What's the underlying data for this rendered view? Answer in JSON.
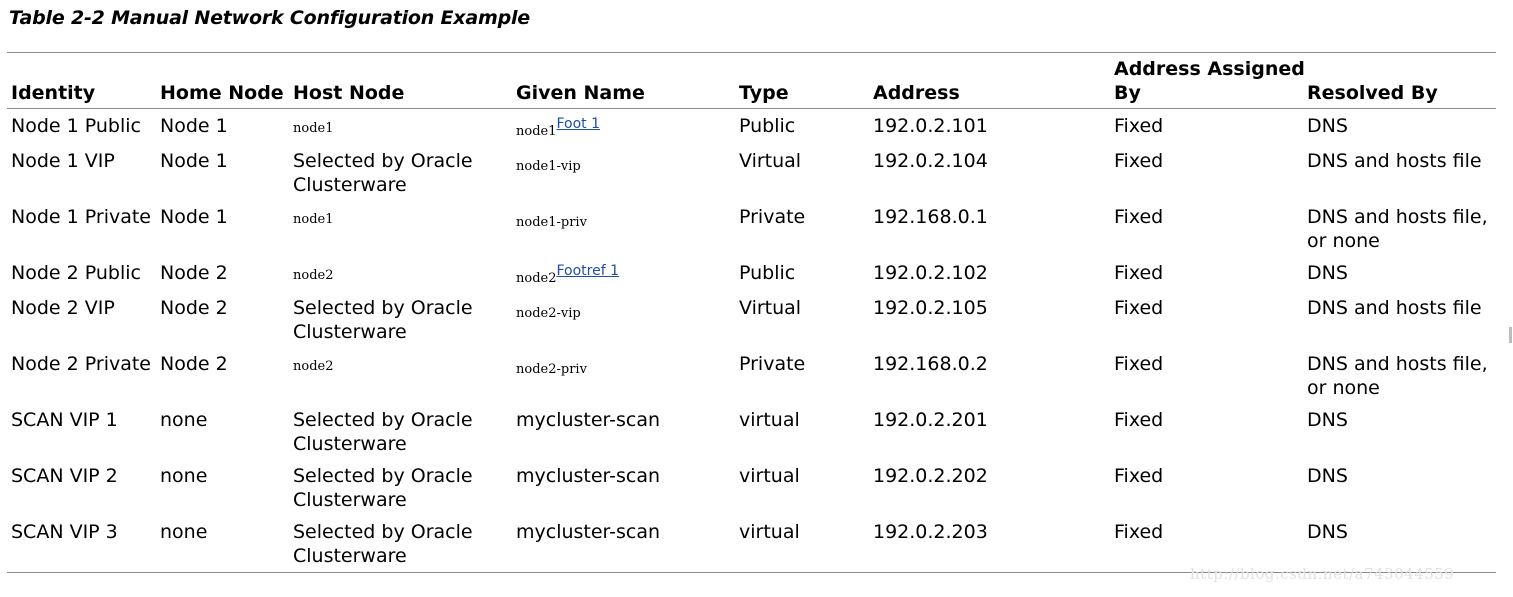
{
  "caption": "Table 2-2 Manual Network Configuration Example",
  "headers": {
    "identity": "Identity",
    "home_node": "Home Node",
    "host_node": "Host Node",
    "given_name": "Given Name",
    "type": "Type",
    "address": "Address",
    "assigned_line1": "Address Assigned",
    "assigned_line2": "By",
    "resolved_by": "Resolved By"
  },
  "rows": [
    {
      "identity": "Node 1 Public",
      "home": "Node 1",
      "host": "node1",
      "host_mono": true,
      "given": "node1",
      "given_mono": true,
      "footnote": "Foot 1 ",
      "type": "Public",
      "address": "192.0.2.101",
      "assigned": "Fixed",
      "resolved": "DNS"
    },
    {
      "identity": "Node 1 VIP",
      "home": "Node 1",
      "host": "Selected by Oracle\nClusterware",
      "host_mono": false,
      "given": "node1-vip",
      "given_mono": true,
      "type": "Virtual",
      "address": "192.0.2.104",
      "assigned": "Fixed",
      "resolved": "DNS and hosts file"
    },
    {
      "identity": "Node 1 Private",
      "home": "Node 1",
      "host": "node1",
      "host_mono": true,
      "given": "node1-priv",
      "given_mono": true,
      "type": "Private",
      "address": "192.168.0.1",
      "assigned": "Fixed",
      "resolved": "DNS and hosts file,\nor none"
    },
    {
      "identity": "Node 2 Public",
      "home": "Node 2",
      "host": "node2",
      "host_mono": true,
      "given": "node2",
      "given_mono": true,
      "footnote": "Footref 1",
      "type": "Public",
      "address": "192.0.2.102",
      "assigned": "Fixed",
      "resolved": "DNS"
    },
    {
      "identity": "Node 2 VIP",
      "home": "Node 2",
      "host": "Selected by Oracle\nClusterware",
      "host_mono": false,
      "given": "node2-vip",
      "given_mono": true,
      "type": "Virtual",
      "address": "192.0.2.105",
      "assigned": "Fixed",
      "resolved": "DNS and hosts file"
    },
    {
      "identity": "Node 2 Private",
      "home": "Node 2",
      "host": "node2",
      "host_mono": true,
      "given": "node2-priv",
      "given_mono": true,
      "type": "Private",
      "address": "192.168.0.2",
      "assigned": "Fixed",
      "resolved": "DNS and hosts file,\nor none"
    },
    {
      "identity": "SCAN VIP 1",
      "home": "none",
      "host": "Selected by Oracle\nClusterware",
      "host_mono": false,
      "given": "mycluster-scan",
      "given_mono": false,
      "type": "virtual",
      "address": "192.0.2.201",
      "assigned": "Fixed",
      "resolved": "DNS"
    },
    {
      "identity": "SCAN VIP 2",
      "home": "none",
      "host": "Selected by Oracle\nClusterware",
      "host_mono": false,
      "given": "mycluster-scan",
      "given_mono": false,
      "type": "virtual",
      "address": "192.0.2.202",
      "assigned": "Fixed",
      "resolved": "DNS"
    },
    {
      "identity": "SCAN VIP 3",
      "home": "none",
      "host": "Selected by Oracle\nClusterware",
      "host_mono": false,
      "given": "mycluster-scan",
      "given_mono": false,
      "type": "virtual",
      "address": "192.0.2.203",
      "assigned": "Fixed",
      "resolved": "DNS"
    }
  ],
  "watermark": "http://blog.csdn.net/a743044559"
}
